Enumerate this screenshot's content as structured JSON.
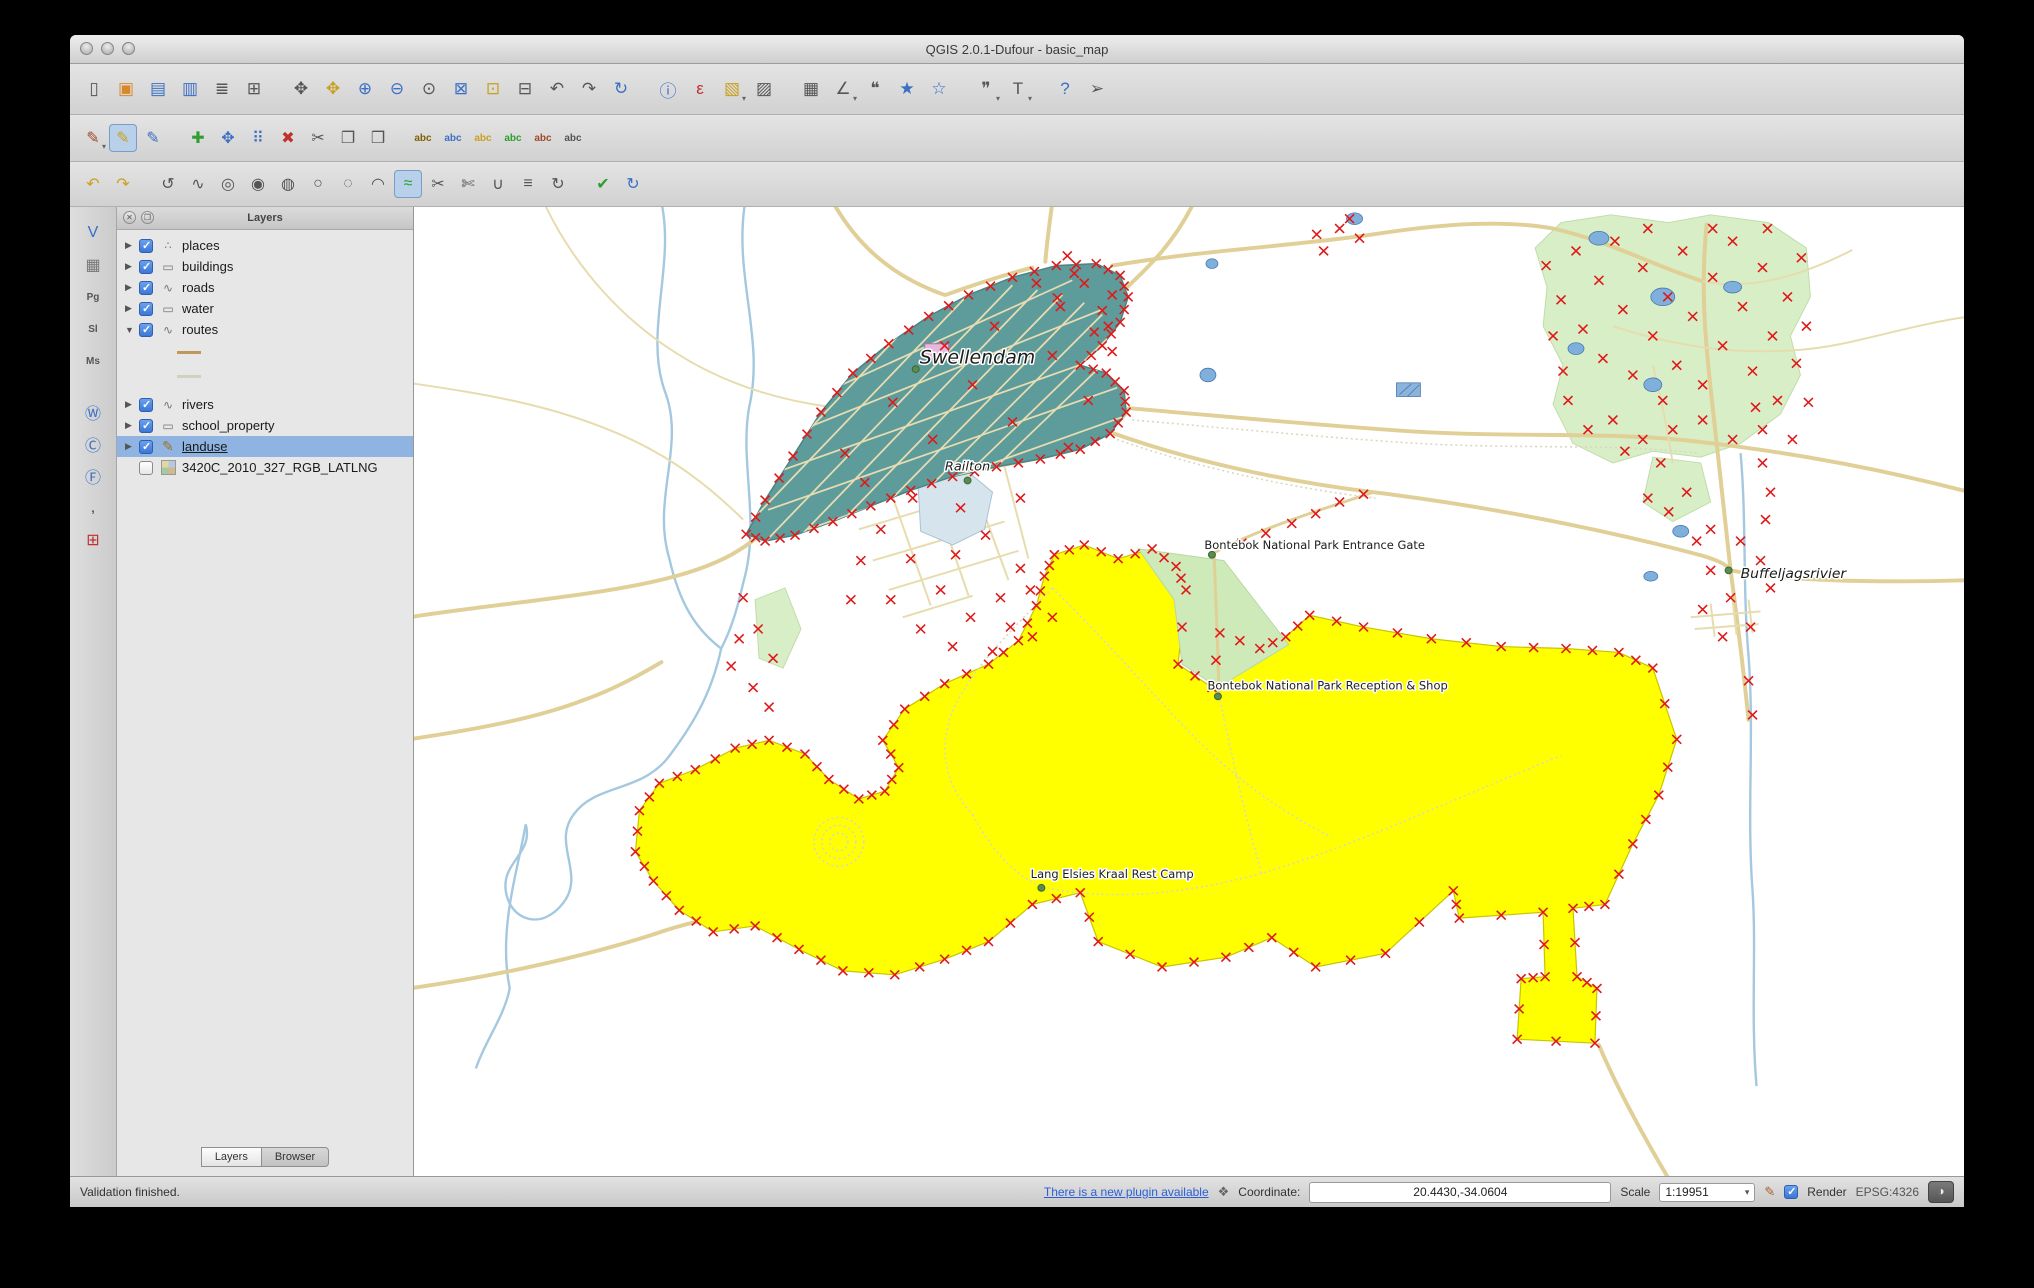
{
  "window": {
    "title": "QGIS 2.0.1-Dufour - basic_map"
  },
  "toolbar_row1": [
    {
      "name": "new-project",
      "glyph": "▯"
    },
    {
      "name": "open-project",
      "glyph": "▣",
      "color": "#d8882a"
    },
    {
      "name": "save-project",
      "glyph": "▤",
      "color": "#3b6fc4"
    },
    {
      "name": "save-project-as",
      "glyph": "▥",
      "color": "#3b6fc4"
    },
    {
      "name": "new-composer",
      "glyph": "≣"
    },
    {
      "name": "composer-manager",
      "glyph": "⊞"
    },
    {
      "name": "pan-map",
      "glyph": "✥",
      "gap": true
    },
    {
      "name": "pan-to-selection",
      "glyph": "✥",
      "color": "#c8a020"
    },
    {
      "name": "zoom-in",
      "glyph": "⊕",
      "color": "#3b6fc4"
    },
    {
      "name": "zoom-out",
      "glyph": "⊖",
      "color": "#3b6fc4"
    },
    {
      "name": "zoom-native",
      "glyph": "⊙"
    },
    {
      "name": "zoom-full",
      "glyph": "⊠",
      "color": "#3b6fc4"
    },
    {
      "name": "zoom-to-selection",
      "glyph": "⊡",
      "color": "#c8a020"
    },
    {
      "name": "zoom-to-layer",
      "glyph": "⊟"
    },
    {
      "name": "zoom-last",
      "glyph": "↶"
    },
    {
      "name": "zoom-next",
      "glyph": "↷"
    },
    {
      "name": "refresh-map",
      "glyph": "↻",
      "color": "#3b6fc4"
    },
    {
      "name": "identify-features",
      "glyph": "ⓘ",
      "color": "#3b6fc4",
      "gap": true
    },
    {
      "name": "run-feature-action",
      "glyph": "ε",
      "color": "#c03030"
    },
    {
      "name": "select-features",
      "glyph": "▧",
      "color": "#c8a020",
      "menu": true
    },
    {
      "name": "deselect-features",
      "glyph": "▨"
    },
    {
      "name": "attribute-table",
      "glyph": "▦",
      "gap": true
    },
    {
      "name": "measure",
      "glyph": "∠",
      "menu": true
    },
    {
      "name": "map-tips",
      "glyph": "❝"
    },
    {
      "name": "new-bookmark",
      "glyph": "★",
      "color": "#3b6fc4"
    },
    {
      "name": "show-bookmarks",
      "glyph": "☆",
      "color": "#3b6fc4"
    },
    {
      "name": "annotation",
      "glyph": "❞",
      "menu": true,
      "gap": true
    },
    {
      "name": "text-annotation",
      "glyph": "T",
      "menu": true
    },
    {
      "name": "help-contents",
      "glyph": "?",
      "color": "#3b6fc4",
      "gap": true
    },
    {
      "name": "whats-this",
      "glyph": "➢"
    }
  ],
  "toolbar_row2": [
    {
      "name": "current-edits",
      "glyph": "✎",
      "color": "#a04828",
      "menu": true
    },
    {
      "name": "toggle-editing",
      "glyph": "✎",
      "color": "#c8a020",
      "active": true
    },
    {
      "name": "save-layer-edits",
      "glyph": "✎",
      "color": "#3b6fc4"
    },
    {
      "name": "add-feature",
      "glyph": "✚",
      "color": "#2f9e2f",
      "gap": true
    },
    {
      "name": "move-feature",
      "glyph": "✥",
      "color": "#3b6fc4"
    },
    {
      "name": "node-tool",
      "glyph": "⠿",
      "color": "#3b6fc4"
    },
    {
      "name": "delete-selected",
      "glyph": "✖",
      "color": "#c03030"
    },
    {
      "name": "cut-features",
      "glyph": "✂"
    },
    {
      "name": "copy-features",
      "glyph": "❐"
    },
    {
      "name": "paste-features",
      "glyph": "❒"
    },
    {
      "name": "labeling-options",
      "glyph": "abc",
      "small": true,
      "color": "#806000",
      "gap": true
    },
    {
      "name": "pin-unpin-labels",
      "glyph": "abc",
      "small": true,
      "color": "#3b6fc4"
    },
    {
      "name": "highlight-pinned-labels",
      "glyph": "abc",
      "small": true,
      "color": "#c8a020"
    },
    {
      "name": "move-label",
      "glyph": "abc",
      "small": true,
      "color": "#2f9e2f"
    },
    {
      "name": "rotate-label",
      "glyph": "abc",
      "small": true,
      "color": "#a04828"
    },
    {
      "name": "change-label-properties",
      "glyph": "abc",
      "small": true,
      "color": "#555555"
    }
  ],
  "toolbar_row3": [
    {
      "name": "undo",
      "glyph": "↶",
      "color": "#c8a020"
    },
    {
      "name": "redo",
      "glyph": "↷",
      "color": "#c8a020"
    },
    {
      "name": "rotate-feature",
      "glyph": "↺",
      "gap": true
    },
    {
      "name": "simplify-feature",
      "glyph": "∿"
    },
    {
      "name": "add-ring",
      "glyph": "◎"
    },
    {
      "name": "add-part",
      "glyph": "◉"
    },
    {
      "name": "fill-ring",
      "glyph": "◍"
    },
    {
      "name": "delete-ring",
      "glyph": "○"
    },
    {
      "name": "delete-part",
      "glyph": "◌"
    },
    {
      "name": "reshape-features",
      "glyph": "◠"
    },
    {
      "name": "offset-curve",
      "glyph": "≈",
      "color": "#2f9e2f",
      "active": true
    },
    {
      "name": "split-features",
      "glyph": "✂"
    },
    {
      "name": "split-parts",
      "glyph": "✄"
    },
    {
      "name": "merge-features",
      "glyph": "∪"
    },
    {
      "name": "merge-attributes",
      "glyph": "≡"
    },
    {
      "name": "rotate-point-symbols",
      "glyph": "↻"
    },
    {
      "name": "check-geometry",
      "glyph": "✔",
      "color": "#2f9e2f",
      "gap": true
    },
    {
      "name": "reload-edits",
      "glyph": "↻",
      "color": "#3b6fc4"
    }
  ],
  "side_toolbar": [
    {
      "name": "add-vector-layer",
      "glyph": "V",
      "color": "#3b6fc4"
    },
    {
      "name": "add-raster-layer",
      "glyph": "▦",
      "color": "#777777"
    },
    {
      "name": "add-postgis-layer",
      "glyph": "Pg",
      "small": true
    },
    {
      "name": "add-spatialite-layer",
      "glyph": "Sl",
      "small": true
    },
    {
      "name": "add-mssql-layer",
      "glyph": "Ms",
      "small": true
    },
    {
      "name": "add-wms-layer",
      "glyph": "Ⓦ",
      "color": "#3b6fc4",
      "gap": true
    },
    {
      "name": "add-wcs-layer",
      "glyph": "Ⓒ",
      "color": "#3b6fc4"
    },
    {
      "name": "add-wfs-layer",
      "glyph": "Ⓕ",
      "color": "#3b6fc4"
    },
    {
      "name": "add-delimited-text-layer",
      "glyph": ",",
      "color": "#444444"
    },
    {
      "name": "new-shapefile-layer",
      "glyph": "⊞",
      "color": "#c03030"
    }
  ],
  "layers_panel": {
    "title": "Layers",
    "layers": [
      {
        "name": "places",
        "checked": true,
        "type": "point"
      },
      {
        "name": "buildings",
        "checked": true,
        "type": "polygon"
      },
      {
        "name": "roads",
        "checked": true,
        "type": "line"
      },
      {
        "name": "water",
        "checked": true,
        "type": "polygon"
      },
      {
        "name": "routes",
        "checked": true,
        "type": "line",
        "expanded": true,
        "sublegend": true
      },
      {
        "name": "rivers",
        "checked": true,
        "type": "line"
      },
      {
        "name": "school_property",
        "checked": true,
        "type": "polygon"
      },
      {
        "name": "landuse",
        "checked": true,
        "type": "editing",
        "selected": true
      },
      {
        "name": "3420C_2010_327_RGB_LATLNG",
        "checked": false,
        "type": "raster",
        "noexp": true
      }
    ],
    "tabs": [
      {
        "name": "layers",
        "label": "Layers",
        "active": true
      },
      {
        "name": "browser",
        "label": "Browser"
      }
    ]
  },
  "map": {
    "labels": {
      "town": "Swellendam",
      "suburb": "Railton",
      "gate": "Bontebok National Park Entrance Gate",
      "reception": "Bontebok National Park Reception & Shop",
      "camp": "Lang Elsies Kraal Rest Camp",
      "river": "Buffeljagsrivier"
    }
  },
  "status_bar": {
    "message": "Validation finished.",
    "plugin_link": "There is a new plugin available",
    "plugin_icon_glyph": "❖",
    "coordinate_label": "Coordinate:",
    "coordinate_value": "20.4430,-34.0604",
    "scale_label": "Scale",
    "scale_value": "1:19951",
    "stop_icon_glyph": "✎",
    "render_label": "Render",
    "crs": "EPSG:4326",
    "crs_icon_glyph": "◑"
  }
}
